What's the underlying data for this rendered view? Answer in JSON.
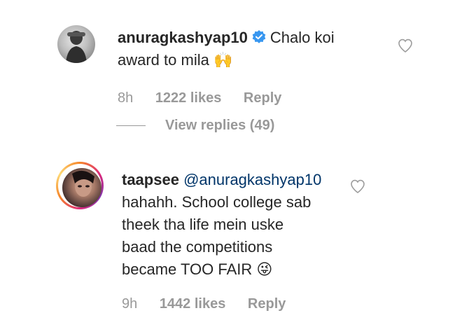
{
  "comments": [
    {
      "username": "anuragkashyap10",
      "verified": true,
      "text_line1": "Chalo koi",
      "text_line2": "award to mila",
      "emoji": "🙌",
      "age": "8h",
      "likes": "1222 likes",
      "reply_label": "Reply",
      "view_replies": "View replies (49)",
      "avatar_icon": "profile-photo"
    },
    {
      "username": "taapsee",
      "mention": "@anuragkashyap10",
      "text_lines": [
        "hahahh. School college sab",
        "theek tha life mein uske",
        "baad the competitions"
      ],
      "text_last": "became TOO FAIR",
      "emoji": "😜",
      "age": "9h",
      "likes": "1442 likes",
      "reply_label": "Reply",
      "avatar_icon": "profile-photo-story-ring"
    }
  ],
  "colors": {
    "text": "#262626",
    "meta": "#999999",
    "mention": "#003569",
    "verified": "#3897f0"
  }
}
